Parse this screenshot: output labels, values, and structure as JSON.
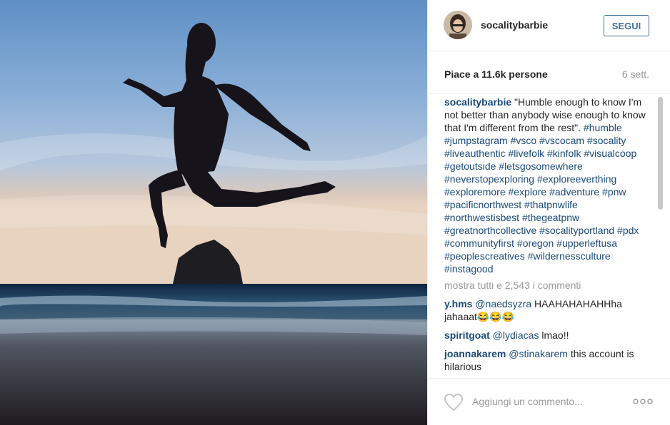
{
  "post": {
    "username": "socalitybarbie",
    "follow_label": "SEGUI",
    "likes": "Piace a 11.6k persone",
    "time": "6 sett.",
    "caption_user": "socalitybarbie",
    "caption_text": "\"Humble enough to know I'm not better than anybody wise enough to know that I'm different from the rest\".",
    "caption_tags": "#humble #jumpstagram #vsco #vscocam #socality #liveauthentic #livefolk #kinfolk #visualcoop #getoutside #letsgosomewhere #neverstopexploring #exploreeverthing #exploremore #explore #adventure #pnw #pacificnorthwest #thatpnwlife #northwestisbest #thegeatpnw #greatnorthcollective #socalityportland #pdx #communityfirst #oregon #upperleftusa #peoplescreatives #wildernessculture #instagood",
    "show_all": "mostra tutti e 2,543 i commenti"
  },
  "comments": [
    {
      "user": "y.hms",
      "mention": "@naedsyzra",
      "text": "HAAHAHAHAHHha jahaaat😂😂😂"
    },
    {
      "user": "spiritgoat",
      "mention": "@lydiacas",
      "text": "lmao!!"
    },
    {
      "user": "joannakarem",
      "mention": "@stinakarem",
      "text": "this account is hilarious"
    }
  ],
  "footer": {
    "comment_placeholder": "Aggiungi un commento..."
  },
  "icons": {
    "like": "heart-icon",
    "options": "more-options-icon"
  },
  "colors": {
    "link_blue": "#3f729b",
    "username_blue": "#1c4a7a",
    "muted_gray": "#999999"
  }
}
